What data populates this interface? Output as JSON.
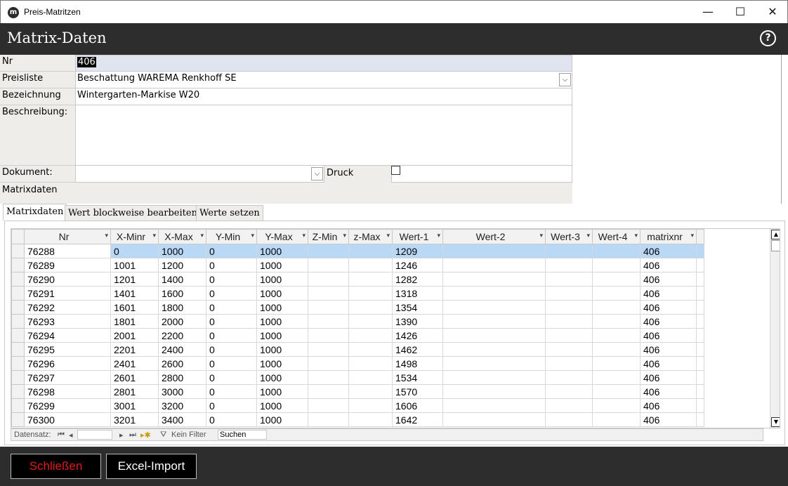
{
  "window": {
    "title": "Preis-Matritzen",
    "minimize": "—",
    "maximize": "☐",
    "close": "✕"
  },
  "header": {
    "title": "Matrix-Daten",
    "help": "?"
  },
  "form": {
    "nr_label": "Nr",
    "nr_value": "406",
    "preisliste_label": "Preisliste",
    "preisliste_value": "Beschattung WAREMA Renkhoff SE",
    "bezeichnung_label": "Bezeichnung",
    "bezeichnung_value": "Wintergarten-Markise W20",
    "beschreibung_label": "Beschreibung:",
    "beschreibung_value": "",
    "dokument_label": "Dokument:",
    "dokument_value": "",
    "druck_label": "Druck",
    "druck_checked": false,
    "matrixdaten_label": "Matrixdaten"
  },
  "tabs": [
    {
      "label": "Matrixdaten",
      "active": true
    },
    {
      "label": "Wert blockweise bearbeiten",
      "active": false
    },
    {
      "label": "Werte setzen",
      "active": false
    }
  ],
  "grid": {
    "columns": [
      "Nr",
      "X-Minr",
      "X-Max",
      "Y-Min",
      "Y-Max",
      "Z-Min",
      "z-Max",
      "Wert-1",
      "Wert-2",
      "Wert-3",
      "Wert-4",
      "matrixnr"
    ],
    "rows": [
      [
        "76288",
        "0",
        "1000",
        "0",
        "1000",
        "",
        "",
        "1209",
        "",
        "",
        "",
        "406"
      ],
      [
        "76289",
        "1001",
        "1200",
        "0",
        "1000",
        "",
        "",
        "1246",
        "",
        "",
        "",
        "406"
      ],
      [
        "76290",
        "1201",
        "1400",
        "0",
        "1000",
        "",
        "",
        "1282",
        "",
        "",
        "",
        "406"
      ],
      [
        "76291",
        "1401",
        "1600",
        "0",
        "1000",
        "",
        "",
        "1318",
        "",
        "",
        "",
        "406"
      ],
      [
        "76292",
        "1601",
        "1800",
        "0",
        "1000",
        "",
        "",
        "1354",
        "",
        "",
        "",
        "406"
      ],
      [
        "76293",
        "1801",
        "2000",
        "0",
        "1000",
        "",
        "",
        "1390",
        "",
        "",
        "",
        "406"
      ],
      [
        "76294",
        "2001",
        "2200",
        "0",
        "1000",
        "",
        "",
        "1426",
        "",
        "",
        "",
        "406"
      ],
      [
        "76295",
        "2201",
        "2400",
        "0",
        "1000",
        "",
        "",
        "1462",
        "",
        "",
        "",
        "406"
      ],
      [
        "76296",
        "2401",
        "2600",
        "0",
        "1000",
        "",
        "",
        "1498",
        "",
        "",
        "",
        "406"
      ],
      [
        "76297",
        "2601",
        "2800",
        "0",
        "1000",
        "",
        "",
        "1534",
        "",
        "",
        "",
        "406"
      ],
      [
        "76298",
        "2801",
        "3000",
        "0",
        "1000",
        "",
        "",
        "1570",
        "",
        "",
        "",
        "406"
      ],
      [
        "76299",
        "3001",
        "3200",
        "0",
        "1000",
        "",
        "",
        "1606",
        "",
        "",
        "",
        "406"
      ],
      [
        "76300",
        "3201",
        "3400",
        "0",
        "1000",
        "",
        "",
        "1642",
        "",
        "",
        "",
        "406"
      ]
    ]
  },
  "navbar": {
    "label": "Datensatz:",
    "first": "⏮",
    "prev": "◂",
    "next": "▸",
    "last": "⏭",
    "new": "▸✱",
    "filter_label": "Kein Filter",
    "search_placeholder": "Suchen"
  },
  "footer": {
    "close_label": "Schließen",
    "import_label": "Excel-Import"
  }
}
